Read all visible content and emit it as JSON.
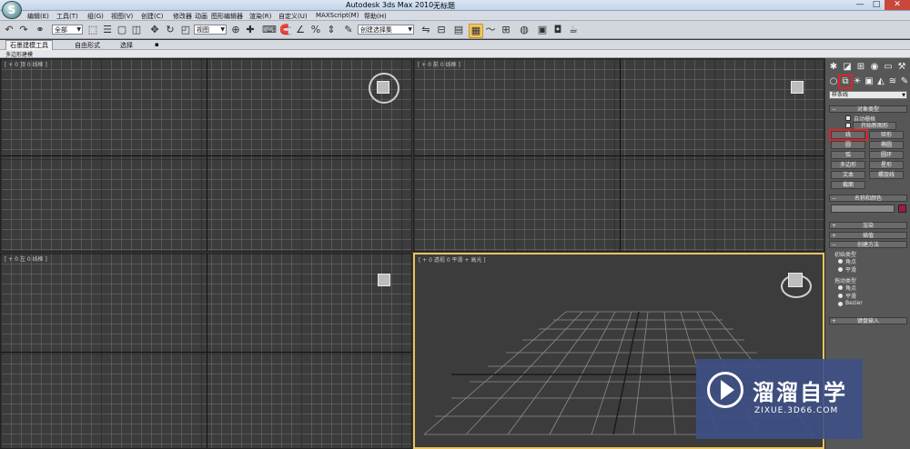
{
  "window": {
    "title": "Autodesk 3ds Max  2010",
    "document": "无标题",
    "app_logo_letter": "S",
    "controls": [
      "—",
      "□",
      "✕"
    ]
  },
  "menu": {
    "items": [
      "编辑(E)",
      "工具(T)",
      "组(G)",
      "视图(V)",
      "创建(C)",
      "修改器",
      "动画",
      "图形编辑器",
      "渲染(R)",
      "自定义(U)",
      "MAXScript(M)",
      "帮助(H)"
    ]
  },
  "toolbar": {
    "selection_filter": "全部",
    "reference_coord": "视图",
    "named_selection": "创建选择集",
    "icons": [
      "undo-icon",
      "redo-icon",
      "link-icon",
      "unlink-icon",
      "bind-space-warp-icon",
      "select-object-icon",
      "select-by-name-icon",
      "rect-region-icon",
      "window-crossing-icon",
      "move-icon",
      "rotate-icon",
      "scale-icon",
      "pivot-icon",
      "manipulate-icon",
      "keyboard-shortcut-icon",
      "snap-icon",
      "angle-snap-icon",
      "percent-snap-icon",
      "spinner-snap-icon",
      "edit-named-selection-icon",
      "mirror-icon",
      "align-icon",
      "layer-manager-icon",
      "graphite-toggle-icon",
      "curve-editor-icon",
      "schematic-view-icon",
      "material-editor-icon",
      "render-setup-icon",
      "rendered-frame-icon",
      "render-icon"
    ]
  },
  "ribbon": {
    "tabs": [
      "石墨建模工具",
      "自由形式",
      "选择",
      "▪"
    ],
    "active_tab": "石墨建模工具",
    "panel_label": "多边形建模"
  },
  "viewports": {
    "top": "[ + 0 顶 0 线框 ]",
    "front": "[ + 0 前 0 线框 ]",
    "left": "[ + 0 左 0 线框 ]",
    "perspective": "[ + 0 透视 0 平滑 + 高光 ]"
  },
  "command_panel": {
    "tabs": [
      "create-tab-icon",
      "modify-tab-icon",
      "hierarchy-tab-icon",
      "motion-tab-icon",
      "display-tab-icon",
      "utilities-tab-icon"
    ],
    "subcategory_icons": [
      "geometry-icon",
      "shapes-icon",
      "lights-icon",
      "cameras-icon",
      "helpers-icon",
      "space-warps-icon",
      "systems-icon"
    ],
    "category_select": "样条线",
    "object_type": {
      "header": "对象类型",
      "auto_grid": "自动栅格",
      "start_new_shape": "开始新图形",
      "buttons": [
        "线",
        "矩形",
        "圆",
        "椭圆",
        "弧",
        "圆环",
        "多边形",
        "星形",
        "文本",
        "螺旋线",
        "截面"
      ],
      "highlighted": "线"
    },
    "name_color": {
      "header": "名称和颜色",
      "swatch": "#a3174e"
    },
    "rollouts": {
      "rendering": "渲染",
      "interpolation": "插值",
      "creation_method": "创建方法",
      "initial_type": "初始类型",
      "initial_options": [
        "角点",
        "平滑"
      ],
      "drag_type": "拖动类型",
      "drag_options": [
        "角点",
        "平滑",
        "Bezier"
      ],
      "keyboard_entry": "键盘输入"
    }
  },
  "watermark": {
    "title": "溜溜自学",
    "url": "ZIXUE.3D66.COM"
  },
  "colors": {
    "active_viewport": "#e8c45d",
    "highlight": "#d9262a",
    "viewport_bg": "#3c3c3c"
  }
}
